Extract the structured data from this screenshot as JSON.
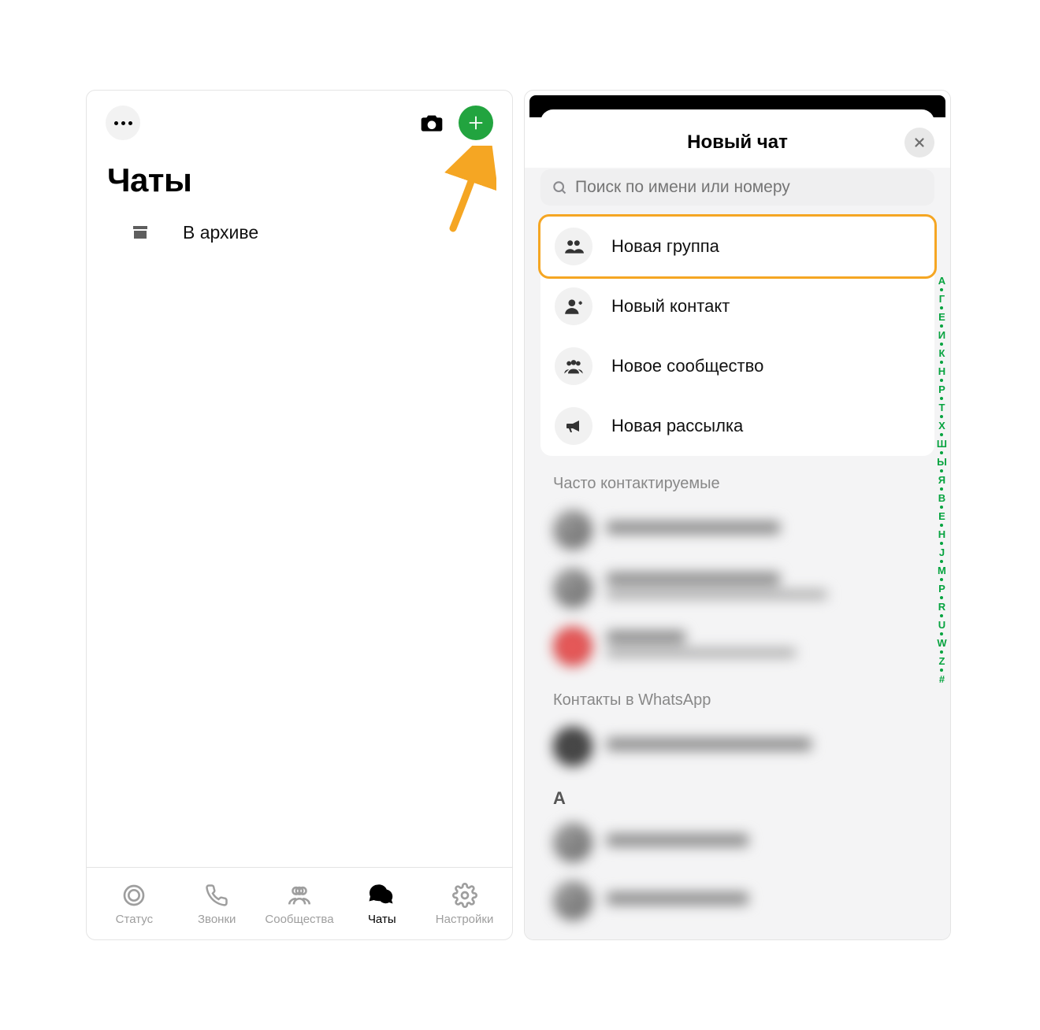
{
  "left": {
    "title": "Чаты",
    "archived_label": "В архиве",
    "tabs": {
      "status": "Статус",
      "calls": "Звонки",
      "communities": "Сообщества",
      "chats": "Чаты",
      "settings": "Настройки"
    }
  },
  "right": {
    "title": "Новый чат",
    "search_placeholder": "Поиск по имени или номеру",
    "actions": {
      "new_group": "Новая группа",
      "new_contact": "Новый контакт",
      "new_community": "Новое сообщество",
      "new_broadcast": "Новая рассылка"
    },
    "group_frequent": "Часто контактируемые",
    "group_whatsapp": "Контакты в WhatsApp",
    "letter_heading_A": "A",
    "index": [
      "А",
      "Г",
      "Е",
      "И",
      "К",
      "Н",
      "Р",
      "Т",
      "Х",
      "Ш",
      "Ы",
      "Я",
      "B",
      "E",
      "H",
      "J",
      "M",
      "P",
      "R",
      "U",
      "W",
      "Z",
      "#"
    ]
  }
}
